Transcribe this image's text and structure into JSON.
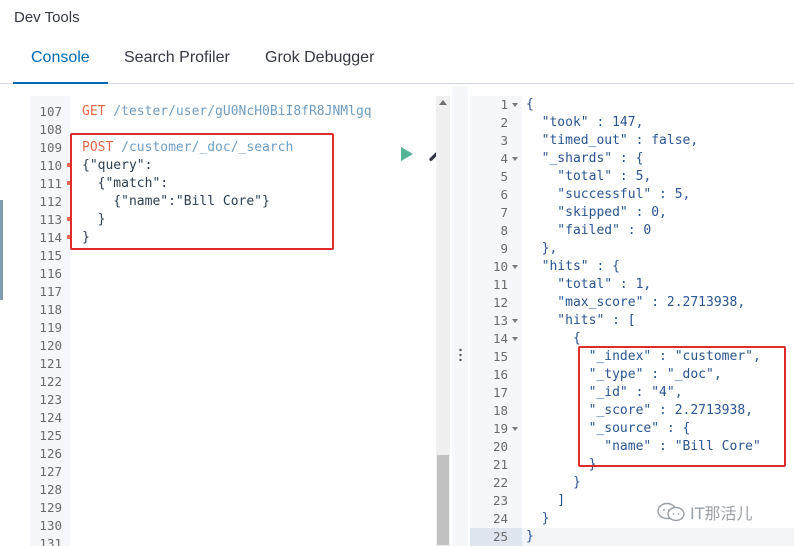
{
  "app": {
    "title": "Dev Tools"
  },
  "tabs": [
    {
      "label": "Console",
      "active": true
    },
    {
      "label": "Search Profiler",
      "active": false
    },
    {
      "label": "Grok Debugger",
      "active": false
    }
  ],
  "request_editor": {
    "line_numbers": [
      "107",
      "108",
      "109",
      "110",
      "111",
      "112",
      "113",
      "114",
      "115",
      "116",
      "117",
      "118",
      "119",
      "120",
      "121",
      "122",
      "123",
      "124",
      "125",
      "126",
      "127",
      "128",
      "129",
      "130",
      "131"
    ],
    "lines": {
      "l107_method": "GET",
      "l107_url": " /tester/user/gU0NcH0BiI8fR8JNMlgq",
      "l109_method": "POST",
      "l109_url": " /customer/_doc/_search",
      "l110": "{\"query\":",
      "l111": "  {\"match\":",
      "l112": "    {\"name\":\"Bill Core\"}",
      "l113": "  }",
      "l114": "}"
    }
  },
  "response_viewer": {
    "line_numbers": [
      "1",
      "2",
      "3",
      "4",
      "5",
      "6",
      "7",
      "8",
      "9",
      "10",
      "11",
      "12",
      "13",
      "14",
      "15",
      "16",
      "17",
      "18",
      "19",
      "20",
      "21",
      "22",
      "23",
      "24",
      "25"
    ],
    "lines": [
      "{",
      "  \"took\" : 147,",
      "  \"timed_out\" : false,",
      "  \"_shards\" : {",
      "    \"total\" : 5,",
      "    \"successful\" : 5,",
      "    \"skipped\" : 0,",
      "    \"failed\" : 0",
      "  },",
      "  \"hits\" : {",
      "    \"total\" : 1,",
      "    \"max_score\" : 2.2713938,",
      "    \"hits\" : [",
      "      {",
      "        \"_index\" : \"customer\",",
      "        \"_type\" : \"_doc\",",
      "        \"_id\" : \"4\",",
      "        \"_score\" : 2.2713938,",
      "        \"_source\" : {",
      "          \"name\" : \"Bill Core\"",
      "        }",
      "      }",
      "    ]",
      "  }",
      "}"
    ]
  },
  "watermark": {
    "text": "IT那活儿"
  },
  "colors": {
    "accent": "#006bb4",
    "method": "#e7664c",
    "highlight_box": "#e02b2b",
    "run": "#54b399"
  }
}
